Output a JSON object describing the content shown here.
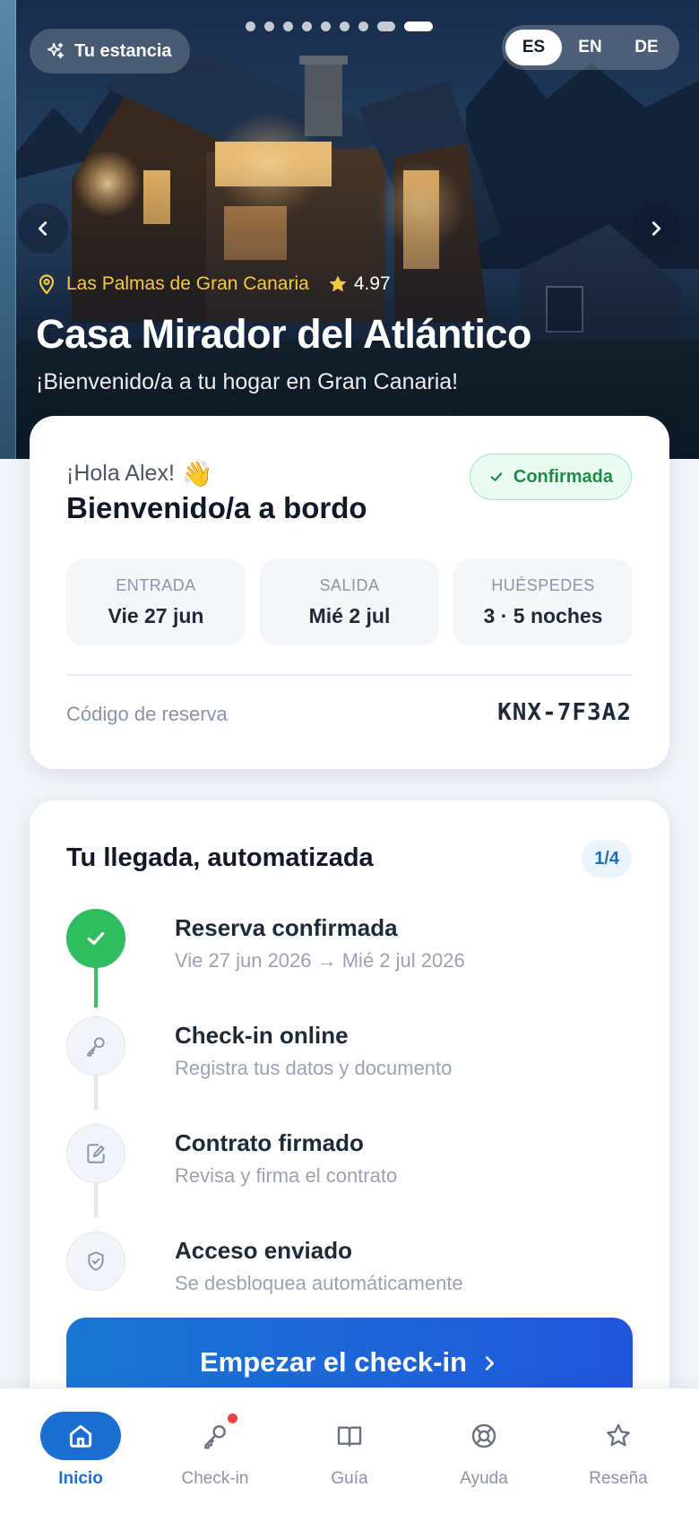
{
  "hero": {
    "stay_label": "Tu estancia",
    "languages": [
      "ES",
      "EN",
      "DE"
    ],
    "active_language": "ES",
    "carousel_total": 9,
    "carousel_active": 9,
    "location": "Las Palmas de Gran Canaria",
    "rating": "4.97",
    "title": "Casa Mirador del Atlántico",
    "subtitle": "¡Bienvenido/a a tu hogar en Gran Canaria!"
  },
  "booking": {
    "greeting": "¡Hola Alex!",
    "greeting_emoji": "👋",
    "heading": "Bienvenido/a a bordo",
    "status": "Confirmada",
    "checkin_label": "ENTRADA",
    "checkin_value": "Vie 27 jun",
    "checkout_label": "SALIDA",
    "checkout_value": "Mié 2 jul",
    "guests_label": "HUÉSPEDES",
    "guests_value": "3 · 5 noches",
    "code_label": "Código de reserva",
    "code_value": "KNX-7F3A2"
  },
  "arrival": {
    "title": "Tu llegada, automatizada",
    "progress": "1/4",
    "steps": [
      {
        "title": "Reserva confirmada",
        "desc": "Vie 27 jun 2026 → Mié 2 jul 2026",
        "done": true,
        "icon": "check-icon"
      },
      {
        "title": "Check-in online",
        "desc": "Registra tus datos y documento",
        "done": false,
        "icon": "key-icon"
      },
      {
        "title": "Contrato firmado",
        "desc": "Revisa y firma el contrato",
        "done": false,
        "icon": "document-sign-icon"
      },
      {
        "title": "Acceso enviado",
        "desc": "Se desbloquea automáticamente",
        "done": false,
        "icon": "shield-icon"
      }
    ],
    "cta_label": "Empezar el check-in"
  },
  "nav": {
    "items": [
      {
        "label": "Inicio",
        "icon": "home-icon",
        "active": true
      },
      {
        "label": "Check-in",
        "icon": "key-icon",
        "badge": true
      },
      {
        "label": "Guía",
        "icon": "book-icon"
      },
      {
        "label": "Ayuda",
        "icon": "lifebuoy-icon"
      },
      {
        "label": "Reseña",
        "icon": "star-icon"
      }
    ]
  },
  "colors": {
    "primary": "#1b6fd1",
    "success": "#2fbd5f",
    "accent_gold": "#f6c945",
    "badge_bg": "#ecfbf1"
  }
}
